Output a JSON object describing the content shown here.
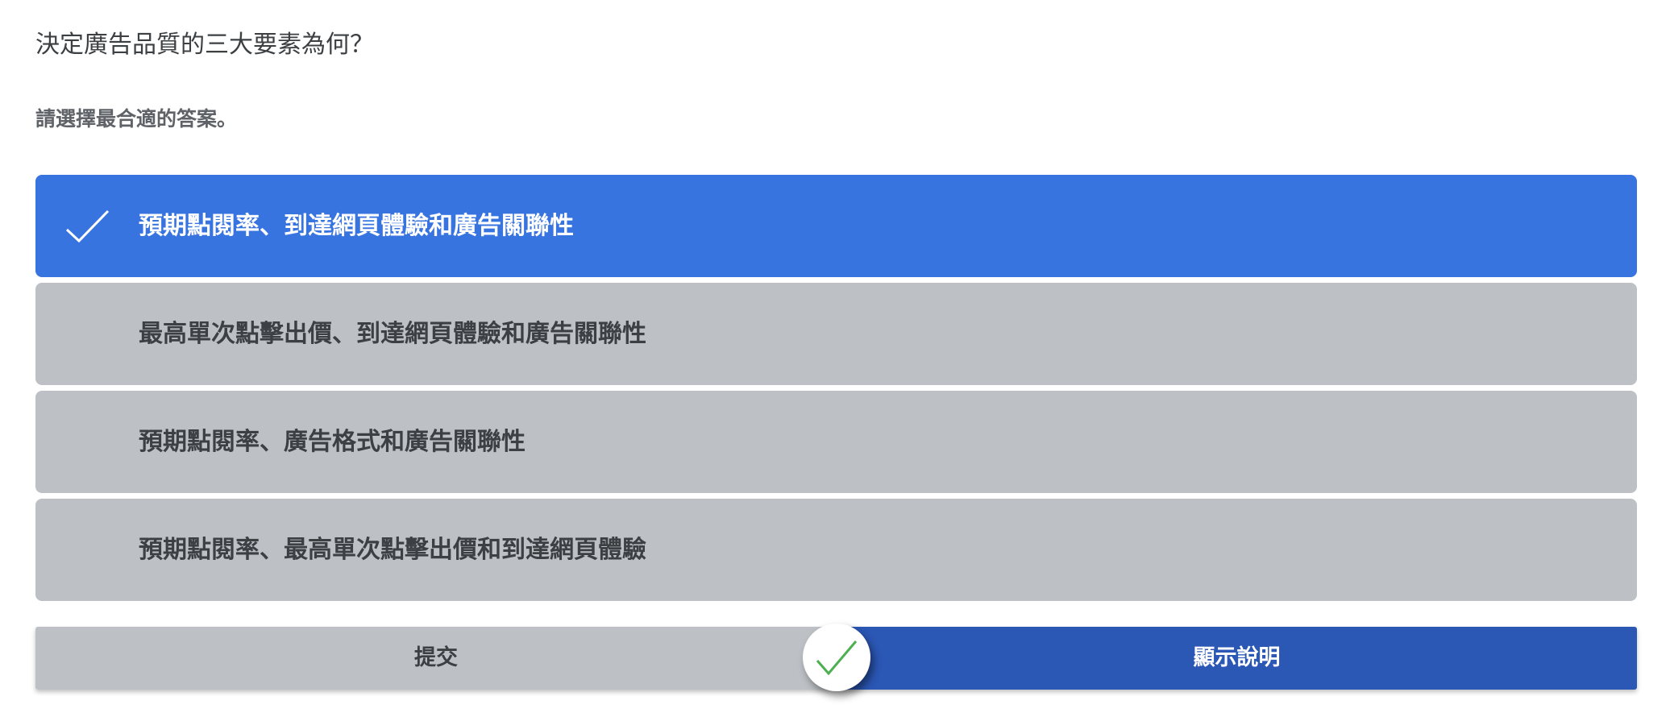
{
  "quiz": {
    "question": "決定廣告品質的三大要素為何？",
    "instruction": "請選擇最合適的答案。",
    "options": [
      {
        "label": "預期點閱率、到達網頁體驗和廣告關聯性",
        "selected": true
      },
      {
        "label": "最高單次點擊出價、到達網頁體驗和廣告關聯性",
        "selected": false
      },
      {
        "label": "預期點閱率、廣告格式和廣告關聯性",
        "selected": false
      },
      {
        "label": "預期點閱率、最高單次點擊出價和到達網頁體驗",
        "selected": false
      }
    ],
    "actions": {
      "submit_label": "提交",
      "explain_label": "顯示說明"
    },
    "status_icon": "check-icon",
    "colors": {
      "selected_option": "#3874e0",
      "unselected_option": "#bdc1c6",
      "explain_button": "#2b57b5",
      "correct_check": "#4caf50"
    }
  }
}
